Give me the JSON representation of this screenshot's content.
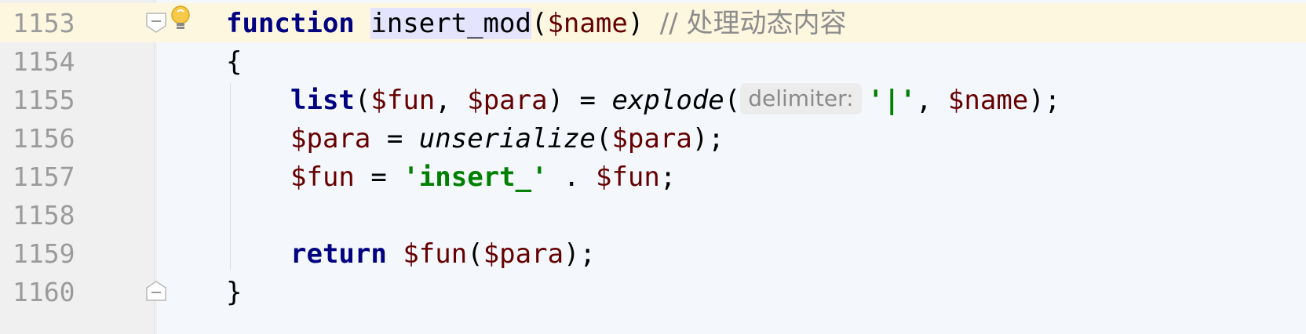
{
  "editor": {
    "lines": [
      {
        "number": "1153"
      },
      {
        "number": "1154"
      },
      {
        "number": "1155"
      },
      {
        "number": "1156"
      },
      {
        "number": "1157"
      },
      {
        "number": "1158"
      },
      {
        "number": "1159"
      },
      {
        "number": "1160"
      }
    ],
    "tokens": {
      "l1153_kw": "function",
      "l1153_name": "insert_mod",
      "l1153_open": "(",
      "l1153_param": "$name",
      "l1153_close": ")",
      "l1153_comment": "// 处理动态内容",
      "l1154_brace": "{",
      "l1155_list": "list",
      "l1155_p1": "(",
      "l1155_fun": "$fun",
      "l1155_sep": ", ",
      "l1155_para": "$para",
      "l1155_p2": ") = ",
      "l1155_explode": "explode",
      "l1155_p3": "(",
      "l1155_hint": "delimiter:",
      "l1155_str": "'|'",
      "l1155_sep2": ", ",
      "l1155_name": "$name",
      "l1155_end": ");",
      "l1156_para": "$para",
      "l1156_eq": " = ",
      "l1156_fn": "unserialize",
      "l1156_p": "(",
      "l1156_arg": "$para",
      "l1156_end": ");",
      "l1157_fun": "$fun",
      "l1157_eq": " = ",
      "l1157_str": "'insert_'",
      "l1157_dot": " . ",
      "l1157_fun2": "$fun",
      "l1157_end": ";",
      "l1159_ret": "return",
      "l1159_fun": "$fun",
      "l1159_p": "(",
      "l1159_para": "$para",
      "l1159_end": ");",
      "l1160_brace": "}"
    },
    "icons": {
      "intention": "lightbulb-icon",
      "fold_start": "fold-start-icon",
      "fold_end": "fold-end-icon"
    },
    "colors": {
      "keyword": "#000080",
      "variable": "#660000",
      "string": "#008000",
      "comment": "#8c8c8c",
      "current_line": "#fdf7e0",
      "identifier_highlight": "#e4e4ff"
    }
  }
}
